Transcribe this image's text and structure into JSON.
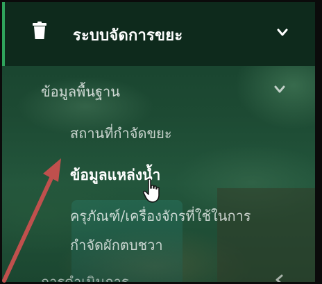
{
  "sidebar": {
    "header_title": "ระบบจัดการขยะ",
    "header_icon": "trash-icon",
    "items": [
      {
        "label": "ข้อมูลพื้นฐาน",
        "expanded": true
      },
      {
        "label": "สถานที่กำจัดขยะ"
      },
      {
        "label": "ข้อมูลแหล่งน้ำ",
        "active": true
      },
      {
        "label_line1": "ครุภัณฑ์/เครื่องจักรที่ใช้ในการ",
        "label_line2": "กำจัดผักตบชวา"
      },
      {
        "label": "การดำเนินการ",
        "expanded": false
      }
    ]
  },
  "colors": {
    "header_bg": "#0e2a1c",
    "accent": "#2fa35b",
    "arrow": "#c0504d"
  }
}
